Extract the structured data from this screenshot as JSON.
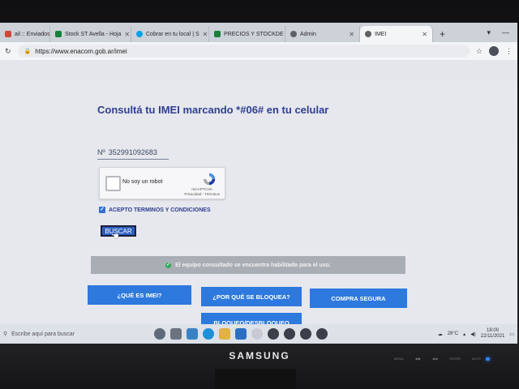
{
  "browser": {
    "tabs": [
      {
        "label": "ail :: Enviados",
        "color": "#d14836",
        "active": false
      },
      {
        "label": "Stock ST Avella - Hoja",
        "color": "#188038",
        "active": false
      },
      {
        "label": "Cobrar en tu local | S",
        "color": "#00a1e4",
        "active": false
      },
      {
        "label": "PRECIOS Y STOCKDE",
        "color": "#188038",
        "active": false
      },
      {
        "label": "Admin",
        "color": "#5f6368",
        "active": false
      },
      {
        "label": "IMEI",
        "color": "#5f6368",
        "active": true
      }
    ],
    "url": "https://www.enacom.gob.ar/imei"
  },
  "page": {
    "title": "Consultá tu IMEI marcando *#06# en tu celular",
    "imei_prefix": "Nº",
    "imei_value": "352991092683",
    "captcha_label": "No soy un robot",
    "captcha_brand": "reCAPTCHA",
    "captcha_links": "Privacidad - Términos",
    "terms_label": "ACEPTO TERMINOS Y CONDICIONES",
    "search_button": "BUSCAR",
    "result_message": "El equipo consultado se encuentra habilitado para el uso.",
    "buttons": {
      "what_is_imei": "¿QUÉ ES IMEI?",
      "why_blocked": "¿POR QUÉ SE BLOQUEA?",
      "safe_purchase": "COMPRA SEGURA",
      "block_unblock": "BLOQUEO/DESBLOQUEO"
    }
  },
  "taskbar": {
    "search_placeholder": "Escribe aquí para buscar",
    "weather": "28°C",
    "time": "18:00",
    "date": "22/11/2021"
  },
  "monitor": {
    "brand": "SAMSUNG",
    "buttons": [
      "MENU",
      "◀/▶",
      "◀ ▶",
      "ENTER",
      "AUTO"
    ]
  },
  "colors": {
    "accent_blue": "#2d79de",
    "title_blue": "#2f3f8f",
    "result_bg": "#a9adb4",
    "ok_green": "#2fae55"
  }
}
